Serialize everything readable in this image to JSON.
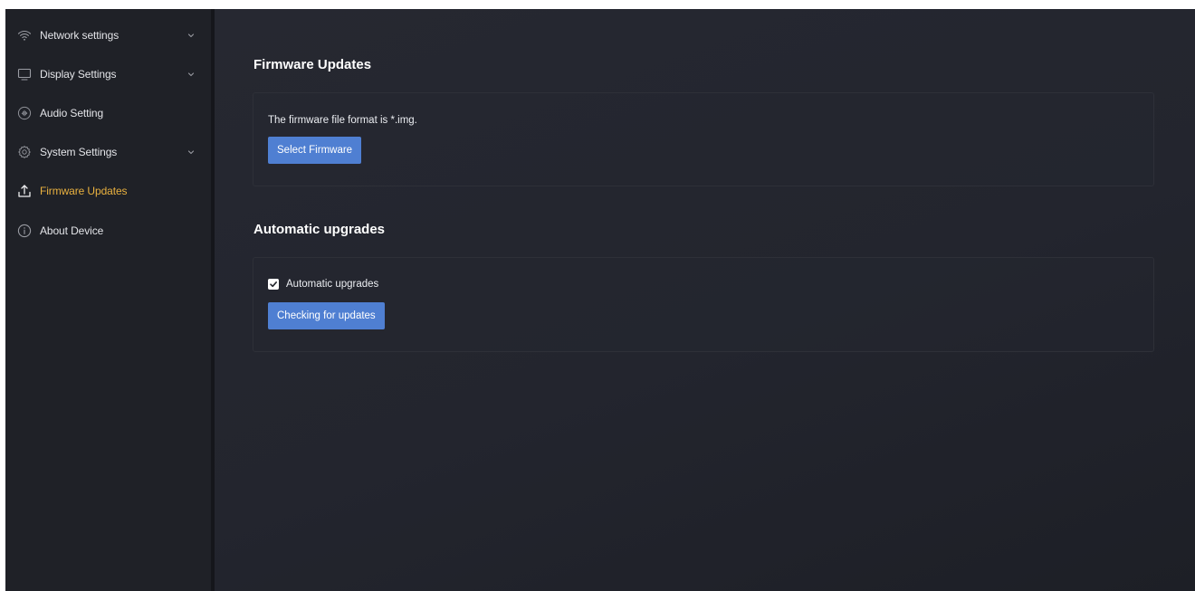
{
  "sidebar": {
    "items": [
      {
        "label": "Network settings",
        "icon": "wifi-icon",
        "has_chevron": true,
        "active": false
      },
      {
        "label": "Display Settings",
        "icon": "monitor-icon",
        "has_chevron": true,
        "active": false
      },
      {
        "label": "Audio Setting",
        "icon": "audio-icon",
        "has_chevron": false,
        "active": false
      },
      {
        "label": "System Settings",
        "icon": "gear-icon",
        "has_chevron": true,
        "active": false
      },
      {
        "label": "Firmware Updates",
        "icon": "upload-icon",
        "has_chevron": false,
        "active": true
      },
      {
        "label": "About Device",
        "icon": "info-icon",
        "has_chevron": false,
        "active": false
      }
    ]
  },
  "firmware": {
    "title": "Firmware Updates",
    "format_text": "The firmware file format is *.img.",
    "select_button": "Select Firmware"
  },
  "auto": {
    "title": "Automatic upgrades",
    "checkbox_label": "Automatic upgrades",
    "checkbox_checked": true,
    "check_button": "Checking for updates"
  },
  "colors": {
    "accent": "#e9b13f",
    "button": "#4f7fd2",
    "background": "#23252c",
    "sidebar": "#1f2127"
  }
}
